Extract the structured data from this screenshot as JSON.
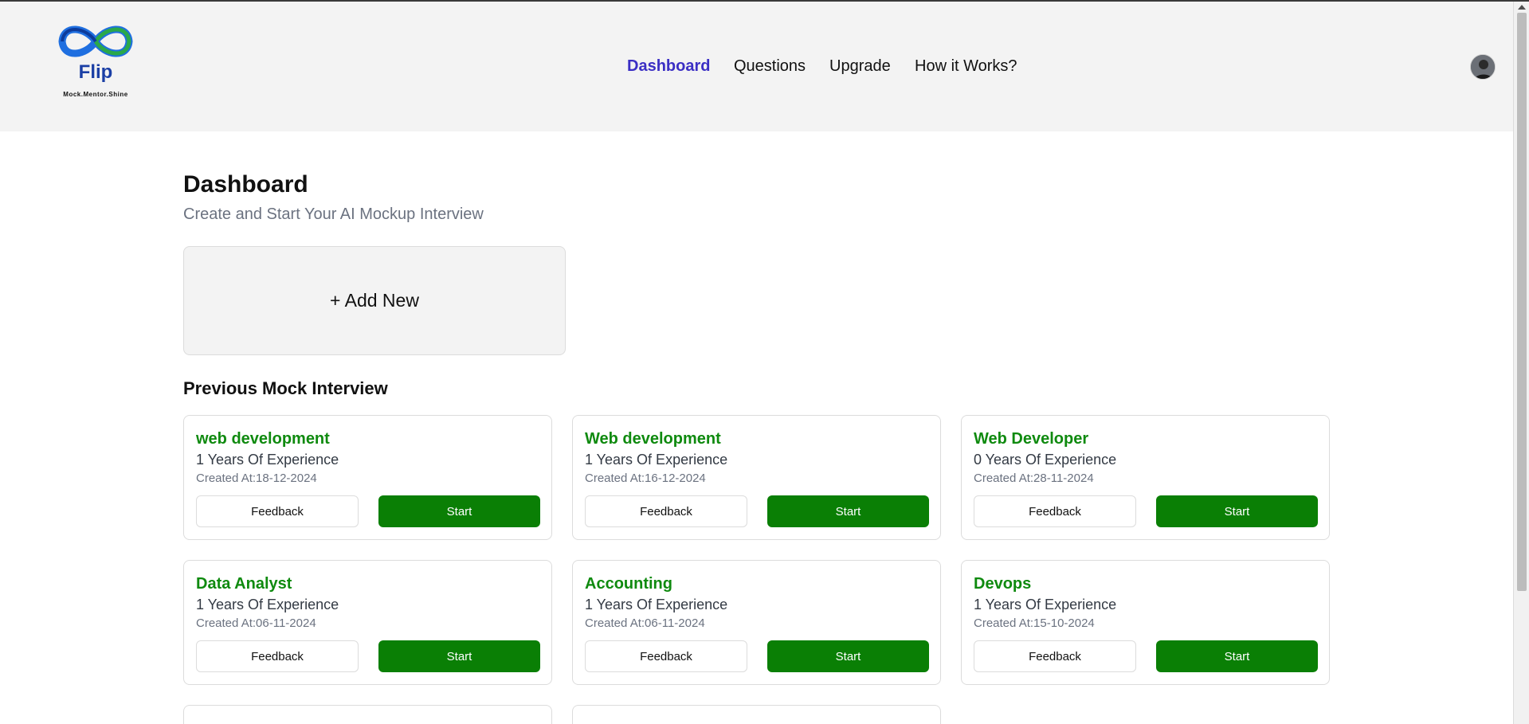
{
  "header": {
    "logo_text": "Flip",
    "logo_tagline": "Mock.Mentor.Shine",
    "nav": [
      "Dashboard",
      "Questions",
      "Upgrade",
      "How it Works?"
    ]
  },
  "main": {
    "title": "Dashboard",
    "subtitle": "Create and Start Your AI Mockup Interview",
    "add_new_label": "+ Add New",
    "section_title": "Previous Mock Interview",
    "interviews": [
      {
        "position": "web development",
        "experience": "1 Years Of Experience",
        "created": "Created At:18-12-2024"
      },
      {
        "position": "Web development",
        "experience": "1 Years Of Experience",
        "created": "Created At:16-12-2024"
      },
      {
        "position": "Web Developer",
        "experience": "0 Years Of Experience",
        "created": "Created At:28-11-2024"
      },
      {
        "position": "Data Analyst",
        "experience": "1 Years Of Experience",
        "created": "Created At:06-11-2024"
      },
      {
        "position": "Accounting",
        "experience": "1 Years Of Experience",
        "created": "Created At:06-11-2024"
      },
      {
        "position": "Devops",
        "experience": "1 Years Of Experience",
        "created": "Created At:15-10-2024"
      }
    ],
    "feedback_label": "Feedback",
    "start_label": "Start"
  },
  "colors": {
    "accent_nav": "#3b2fc4",
    "position_green": "#0f8a0f",
    "start_button": "#0a7f05",
    "header_bg": "#f3f3f3"
  },
  "icons": [
    "infinity-logo-icon",
    "user-avatar-icon"
  ]
}
